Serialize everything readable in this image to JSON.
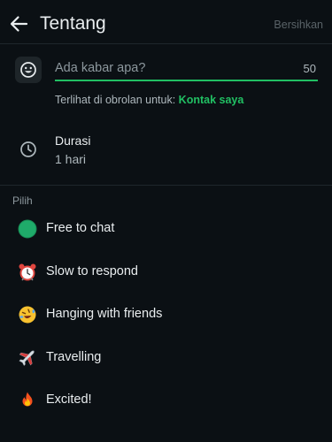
{
  "appbar": {
    "title": "Tentang",
    "clear_label": "Bersihkan"
  },
  "status": {
    "placeholder": "Ada kabar apa?",
    "char_count": "50",
    "visibility_prefix": "Terlihat di obrolan untuk: ",
    "visibility_link": "Kontak saya"
  },
  "duration": {
    "label": "Durasi",
    "value": "1 hari"
  },
  "options": {
    "section_label": "Pilih",
    "items": [
      {
        "label": "Free to chat",
        "icon": "green-circle-icon"
      },
      {
        "label": "Slow to respond",
        "icon": "alarm-clock-icon"
      },
      {
        "label": "Hanging with friends",
        "icon": "laughing-face-icon"
      },
      {
        "label": "Travelling",
        "icon": "airplane-icon"
      },
      {
        "label": "Excited!",
        "icon": "fire-icon"
      }
    ]
  },
  "colors": {
    "background": "#0b1014",
    "accent": "#21c063",
    "text": "#e9edef",
    "muted": "#aeb8bd"
  }
}
